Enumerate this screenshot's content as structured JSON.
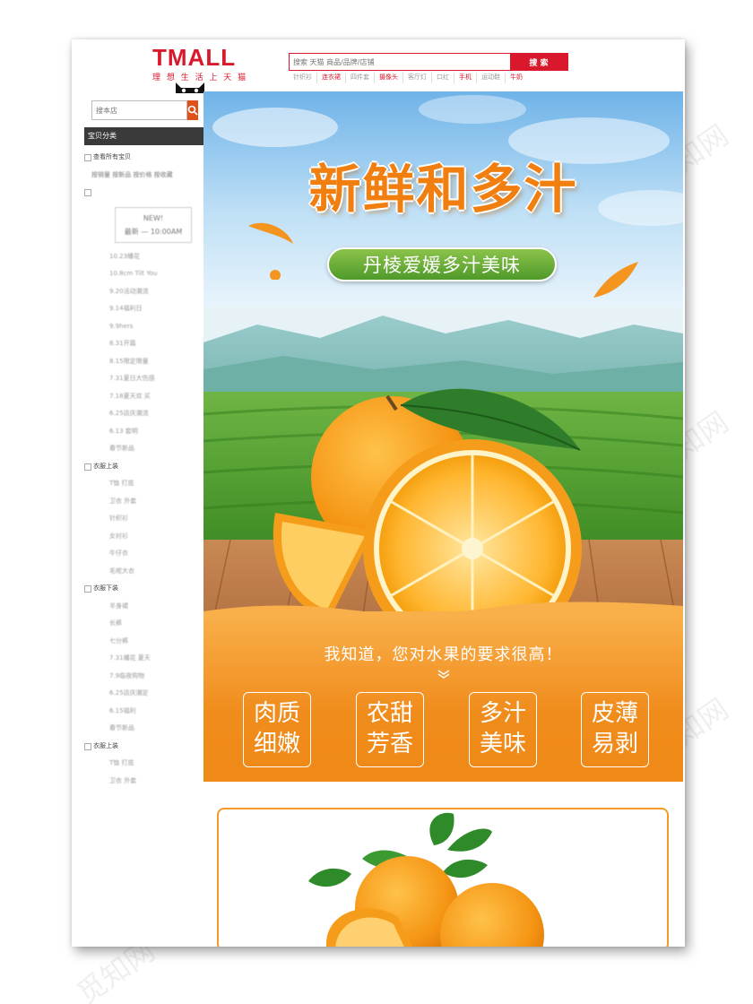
{
  "header": {
    "logo_text": "TMALL",
    "logo_tagline": "理 想 生 活 上 天 猫",
    "search_placeholder": "搜索 天猫 商品/品牌/店铺",
    "search_button": "搜 索",
    "hot_links": [
      {
        "text": "针织衫",
        "highlight": false
      },
      {
        "text": "连衣裙",
        "highlight": true
      },
      {
        "text": "四件套",
        "highlight": false
      },
      {
        "text": "摄像头",
        "highlight": true
      },
      {
        "text": "客厅灯",
        "highlight": false
      },
      {
        "text": "口红",
        "highlight": false
      },
      {
        "text": "手机",
        "highlight": true
      },
      {
        "text": "运动鞋",
        "highlight": false
      },
      {
        "text": "牛奶",
        "highlight": true
      }
    ]
  },
  "sidebar": {
    "search_placeholder": "搜本店",
    "category_header": "宝贝分类",
    "all_label": "查看所有宝贝",
    "sort_tags": "按销量 按新品 按价格 按收藏",
    "new_box_line1": "NEW!",
    "new_box_line2": "最新 — 10:00AM",
    "items_a": [
      "10.23幡花",
      "10.8cm Tilt You",
      "9.20活动潮流",
      "9.14福利日",
      "9.9hers",
      "8.31开篇",
      "8.15限定限量",
      "7.31夏日大伤感",
      "7.18夏天欢 买",
      "6.25店庆潮流",
      "6.13 套明",
      "春节新品"
    ],
    "group_b": "衣服上装",
    "items_b": [
      "T恤 打底",
      "卫衣 外套",
      "针织衫",
      "女衬衫",
      "牛仔衣",
      "毛呢大衣"
    ],
    "group_c": "衣服下装",
    "items_c": [
      "半身裙",
      "长裤",
      "七分裤"
    ],
    "items_d": [
      "7.31幡花 夏天",
      "7.9临夜购物",
      "6.25店庆潮定",
      "6.15福利",
      "春节新品"
    ],
    "group_e": "衣服上装",
    "items_e": [
      "T恤 打底",
      "卫衣 外套"
    ]
  },
  "banner": {
    "headline": "新鲜和多汁",
    "subtitle": "丹棱爱媛多汁美味",
    "tagline": "我知道，您对水果的要求很高！",
    "features": [
      {
        "line1": "肉质",
        "line2": "细嫩"
      },
      {
        "line1": "农甜",
        "line2": "芳香"
      },
      {
        "line1": "多汁",
        "line2": "美味"
      },
      {
        "line1": "皮薄",
        "line2": "易剥"
      }
    ]
  },
  "watermark_text": "觅知网",
  "colors": {
    "tmall_red": "#d9182b",
    "orange_accent": "#f08c1c",
    "green_pill": "#5fa832",
    "sidebar_header": "#3a3a3a"
  },
  "icons": [
    "tmall-cat-icon",
    "search-icon",
    "chevron-down-icon",
    "orange-fruit-illustration",
    "leaf-icon"
  ]
}
